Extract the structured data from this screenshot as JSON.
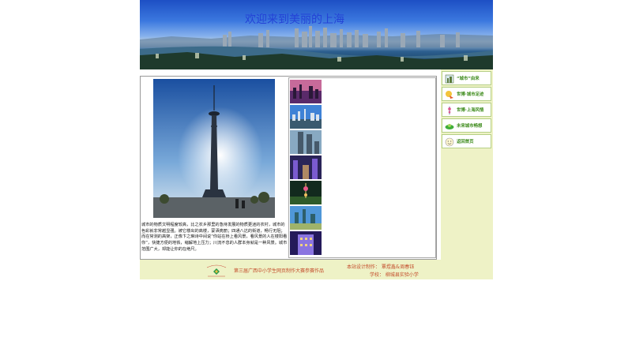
{
  "banner": {
    "title": "欢迎来到美丽的上海"
  },
  "article": {
    "text": "城市的物质文明程度较高，比之农乡那里的急待发展的物质更迷的农村，城市的色彩就非常越显强。被它楼出的高楼，蒙洒亮丽；四通八达的街道，畅行无阻；而在常测的高架，正像卞之琳诗中间说“你站在桥上看风景，看风景的人在楼阳看你”，快捷方便的地铁，缩解地上压力；川流不息的人群本身就是一种风景。城市范围广大，却能让你的在绝尺。"
  },
  "thumbnails": [
    {
      "name": "thumb-sunset-skyline"
    },
    {
      "name": "thumb-bund-day"
    },
    {
      "name": "thumb-twin-towers"
    },
    {
      "name": "thumb-night-street"
    },
    {
      "name": "thumb-night-pearl-tower"
    },
    {
      "name": "thumb-plaza-daytime"
    },
    {
      "name": "thumb-night-building"
    }
  ],
  "sidebar": {
    "items": [
      {
        "label": "“城市”由来",
        "icon": "city-origin-icon"
      },
      {
        "label": "世博·城市足迹",
        "icon": "expo-footprint-icon"
      },
      {
        "label": "世博·上海风情",
        "icon": "shanghai-style-icon"
      },
      {
        "label": "未来城市畅想",
        "icon": "future-city-icon"
      },
      {
        "label": "返回首页",
        "icon": "smiley-home-icon"
      }
    ]
  },
  "footer": {
    "contest": "第三届广西中小学生网页制作大赛参赛作品",
    "credit_line": "本站设计制作： 覃煜鑫&周春钰",
    "school_line": "学校： 柳城县实验小学"
  },
  "colors": {
    "sidebar_bg": "#eef2c6",
    "nav_label": "#3f8c1d",
    "footer_text": "#c34b2a",
    "title_text": "#2442d6"
  }
}
